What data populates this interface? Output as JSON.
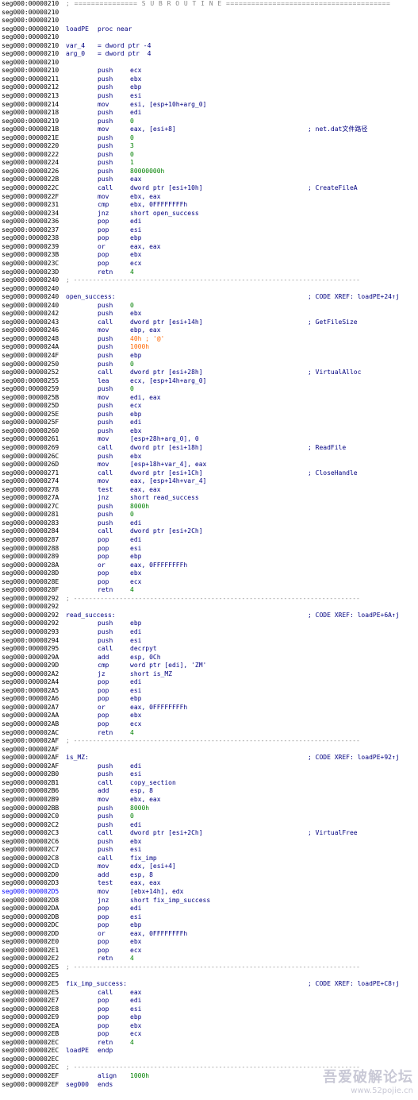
{
  "listing": {
    "lines": [
      {
        "addr": "seg000:00000210",
        "type": "banner",
        "text": "; =============== S U B R O U T I N E ======================================="
      },
      {
        "addr": "seg000:00000210"
      },
      {
        "addr": "seg000:00000210"
      },
      {
        "addr": "seg000:00000210",
        "label": "loadPE",
        "mnem": "proc near"
      },
      {
        "addr": "seg000:00000210"
      },
      {
        "addr": "seg000:00000210",
        "label": "var_4",
        "mnem": "= dword ptr -4"
      },
      {
        "addr": "seg000:00000210",
        "label": "arg_0",
        "mnem": "= dword ptr  4"
      },
      {
        "addr": "seg000:00000210"
      },
      {
        "addr": "seg000:00000210",
        "mnem": "push",
        "ops": "ecx"
      },
      {
        "addr": "seg000:00000211",
        "mnem": "push",
        "ops": "ebx"
      },
      {
        "addr": "seg000:00000212",
        "mnem": "push",
        "ops": "ebp"
      },
      {
        "addr": "seg000:00000213",
        "mnem": "push",
        "ops": "esi"
      },
      {
        "addr": "seg000:00000214",
        "mnem": "mov",
        "ops": "esi, [esp+10h+arg_0]"
      },
      {
        "addr": "seg000:00000218",
        "mnem": "push",
        "ops": "edi"
      },
      {
        "addr": "seg000:00000219",
        "mnem": "push",
        "ops": "0",
        "opsType": "num"
      },
      {
        "addr": "seg000:0000021B",
        "mnem": "mov",
        "ops": "eax, [esi+8]",
        "cmt": "; net.dat文件路径"
      },
      {
        "addr": "seg000:0000021E",
        "mnem": "push",
        "ops": "0",
        "opsType": "num"
      },
      {
        "addr": "seg000:00000220",
        "mnem": "push",
        "ops": "3",
        "opsType": "num"
      },
      {
        "addr": "seg000:00000222",
        "mnem": "push",
        "ops": "0",
        "opsType": "num"
      },
      {
        "addr": "seg000:00000224",
        "mnem": "push",
        "ops": "1",
        "opsType": "num"
      },
      {
        "addr": "seg000:00000226",
        "mnem": "push",
        "ops": "80000000h",
        "opsType": "num"
      },
      {
        "addr": "seg000:0000022B",
        "mnem": "push",
        "ops": "eax"
      },
      {
        "addr": "seg000:0000022C",
        "mnem": "call",
        "ops": "dword ptr [esi+10h]",
        "cmt": "; CreateFileA"
      },
      {
        "addr": "seg000:0000022F",
        "mnem": "mov",
        "ops": "ebx, eax"
      },
      {
        "addr": "seg000:00000231",
        "mnem": "cmp",
        "ops": "ebx, 0FFFFFFFFh"
      },
      {
        "addr": "seg000:00000234",
        "mnem": "jnz",
        "ops": "short open_success"
      },
      {
        "addr": "seg000:00000236",
        "mnem": "pop",
        "ops": "edi"
      },
      {
        "addr": "seg000:00000237",
        "mnem": "pop",
        "ops": "esi"
      },
      {
        "addr": "seg000:00000238",
        "mnem": "pop",
        "ops": "ebp"
      },
      {
        "addr": "seg000:00000239",
        "mnem": "or",
        "ops": "eax, eax"
      },
      {
        "addr": "seg000:0000023B",
        "mnem": "pop",
        "ops": "ebx"
      },
      {
        "addr": "seg000:0000023C",
        "mnem": "pop",
        "ops": "ecx"
      },
      {
        "addr": "seg000:0000023D",
        "mnem": "retn",
        "ops": "4",
        "opsType": "num"
      },
      {
        "addr": "seg000:00000240",
        "type": "sep",
        "text": "; ---------------------------------------------------------------------------"
      },
      {
        "addr": "seg000:00000240"
      },
      {
        "addr": "seg000:00000240",
        "label": "open_success:",
        "cmt": "; CODE XREF: loadPE+24↑j"
      },
      {
        "addr": "seg000:00000240",
        "mnem": "push",
        "ops": "0",
        "opsType": "num"
      },
      {
        "addr": "seg000:00000242",
        "mnem": "push",
        "ops": "ebx"
      },
      {
        "addr": "seg000:00000243",
        "mnem": "call",
        "ops": "dword ptr [esi+14h]",
        "cmt": "; GetFileSize"
      },
      {
        "addr": "seg000:00000246",
        "mnem": "mov",
        "ops": "ebp, eax"
      },
      {
        "addr": "seg000:00000248",
        "mnem": "push",
        "ops": "40h ; '@'",
        "opsType": "hex"
      },
      {
        "addr": "seg000:0000024A",
        "mnem": "push",
        "ops": "1000h",
        "opsType": "hex"
      },
      {
        "addr": "seg000:0000024F",
        "mnem": "push",
        "ops": "ebp"
      },
      {
        "addr": "seg000:00000250",
        "mnem": "push",
        "ops": "0",
        "opsType": "num"
      },
      {
        "addr": "seg000:00000252",
        "mnem": "call",
        "ops": "dword ptr [esi+28h]",
        "cmt": "; VirtualAlloc"
      },
      {
        "addr": "seg000:00000255",
        "mnem": "lea",
        "ops": "ecx, [esp+14h+arg_0]"
      },
      {
        "addr": "seg000:00000259",
        "mnem": "push",
        "ops": "0",
        "opsType": "num"
      },
      {
        "addr": "seg000:0000025B",
        "mnem": "mov",
        "ops": "edi, eax"
      },
      {
        "addr": "seg000:0000025D",
        "mnem": "push",
        "ops": "ecx"
      },
      {
        "addr": "seg000:0000025E",
        "mnem": "push",
        "ops": "ebp"
      },
      {
        "addr": "seg000:0000025F",
        "mnem": "push",
        "ops": "edi"
      },
      {
        "addr": "seg000:00000260",
        "mnem": "push",
        "ops": "ebx"
      },
      {
        "addr": "seg000:00000261",
        "mnem": "mov",
        "ops": "[esp+28h+arg_0], 0"
      },
      {
        "addr": "seg000:00000269",
        "mnem": "call",
        "ops": "dword ptr [esi+18h]",
        "cmt": "; ReadFile"
      },
      {
        "addr": "seg000:0000026C",
        "mnem": "push",
        "ops": "ebx"
      },
      {
        "addr": "seg000:0000026D",
        "mnem": "mov",
        "ops": "[esp+18h+var_4], eax"
      },
      {
        "addr": "seg000:00000271",
        "mnem": "call",
        "ops": "dword ptr [esi+1Ch]",
        "cmt": "; CloseHandle"
      },
      {
        "addr": "seg000:00000274",
        "mnem": "mov",
        "ops": "eax, [esp+14h+var_4]"
      },
      {
        "addr": "seg000:00000278",
        "mnem": "test",
        "ops": "eax, eax"
      },
      {
        "addr": "seg000:0000027A",
        "mnem": "jnz",
        "ops": "short read_success"
      },
      {
        "addr": "seg000:0000027C",
        "mnem": "push",
        "ops": "8000h",
        "opsType": "num"
      },
      {
        "addr": "seg000:00000281",
        "mnem": "push",
        "ops": "0",
        "opsType": "num"
      },
      {
        "addr": "seg000:00000283",
        "mnem": "push",
        "ops": "edi"
      },
      {
        "addr": "seg000:00000284",
        "mnem": "call",
        "ops": "dword ptr [esi+2Ch]"
      },
      {
        "addr": "seg000:00000287",
        "mnem": "pop",
        "ops": "edi"
      },
      {
        "addr": "seg000:00000288",
        "mnem": "pop",
        "ops": "esi"
      },
      {
        "addr": "seg000:00000289",
        "mnem": "pop",
        "ops": "ebp"
      },
      {
        "addr": "seg000:0000028A",
        "mnem": "or",
        "ops": "eax, 0FFFFFFFFh"
      },
      {
        "addr": "seg000:0000028D",
        "mnem": "pop",
        "ops": "ebx"
      },
      {
        "addr": "seg000:0000028E",
        "mnem": "pop",
        "ops": "ecx"
      },
      {
        "addr": "seg000:0000028F",
        "mnem": "retn",
        "ops": "4",
        "opsType": "num"
      },
      {
        "addr": "seg000:00000292",
        "type": "sep",
        "text": "; ---------------------------------------------------------------------------"
      },
      {
        "addr": "seg000:00000292"
      },
      {
        "addr": "seg000:00000292",
        "label": "read_success:",
        "cmt": "; CODE XREF: loadPE+6A↑j"
      },
      {
        "addr": "seg000:00000292",
        "mnem": "push",
        "ops": "ebp"
      },
      {
        "addr": "seg000:00000293",
        "mnem": "push",
        "ops": "edi"
      },
      {
        "addr": "seg000:00000294",
        "mnem": "push",
        "ops": "esi"
      },
      {
        "addr": "seg000:00000295",
        "mnem": "call",
        "ops": "decrpyt"
      },
      {
        "addr": "seg000:0000029A",
        "mnem": "add",
        "ops": "esp, 0Ch"
      },
      {
        "addr": "seg000:0000029D",
        "mnem": "cmp",
        "ops": "word ptr [edi], 'ZM'"
      },
      {
        "addr": "seg000:000002A2",
        "mnem": "jz",
        "ops": "short is_MZ"
      },
      {
        "addr": "seg000:000002A4",
        "mnem": "pop",
        "ops": "edi"
      },
      {
        "addr": "seg000:000002A5",
        "mnem": "pop",
        "ops": "esi"
      },
      {
        "addr": "seg000:000002A6",
        "mnem": "pop",
        "ops": "ebp"
      },
      {
        "addr": "seg000:000002A7",
        "mnem": "or",
        "ops": "eax, 0FFFFFFFFh"
      },
      {
        "addr": "seg000:000002AA",
        "mnem": "pop",
        "ops": "ebx"
      },
      {
        "addr": "seg000:000002AB",
        "mnem": "pop",
        "ops": "ecx"
      },
      {
        "addr": "seg000:000002AC",
        "mnem": "retn",
        "ops": "4",
        "opsType": "num"
      },
      {
        "addr": "seg000:000002AF",
        "type": "sep",
        "text": "; ---------------------------------------------------------------------------"
      },
      {
        "addr": "seg000:000002AF"
      },
      {
        "addr": "seg000:000002AF",
        "label": "is_MZ:",
        "cmt": "; CODE XREF: loadPE+92↑j"
      },
      {
        "addr": "seg000:000002AF",
        "mnem": "push",
        "ops": "edi"
      },
      {
        "addr": "seg000:000002B0",
        "mnem": "push",
        "ops": "esi"
      },
      {
        "addr": "seg000:000002B1",
        "mnem": "call",
        "ops": "copy_section"
      },
      {
        "addr": "seg000:000002B6",
        "mnem": "add",
        "ops": "esp, 8"
      },
      {
        "addr": "seg000:000002B9",
        "mnem": "mov",
        "ops": "ebx, eax"
      },
      {
        "addr": "seg000:000002BB",
        "mnem": "push",
        "ops": "8000h",
        "opsType": "num"
      },
      {
        "addr": "seg000:000002C0",
        "mnem": "push",
        "ops": "0",
        "opsType": "num"
      },
      {
        "addr": "seg000:000002C2",
        "mnem": "push",
        "ops": "edi"
      },
      {
        "addr": "seg000:000002C3",
        "mnem": "call",
        "ops": "dword ptr [esi+2Ch]",
        "cmt": "; VirtualFree"
      },
      {
        "addr": "seg000:000002C6",
        "mnem": "push",
        "ops": "ebx"
      },
      {
        "addr": "seg000:000002C7",
        "mnem": "push",
        "ops": "esi"
      },
      {
        "addr": "seg000:000002C8",
        "mnem": "call",
        "ops": "fix_imp"
      },
      {
        "addr": "seg000:000002CD",
        "mnem": "mov",
        "ops": "edx, [esi+4]"
      },
      {
        "addr": "seg000:000002D0",
        "mnem": "add",
        "ops": "esp, 8"
      },
      {
        "addr": "seg000:000002D3",
        "mnem": "test",
        "ops": "eax, eax"
      },
      {
        "addr": "seg000:000002D5",
        "mnem": "mov",
        "ops": "[ebx+14h], edx",
        "hl": true
      },
      {
        "addr": "seg000:000002D8",
        "mnem": "jnz",
        "ops": "short fix_imp_success"
      },
      {
        "addr": "seg000:000002DA",
        "mnem": "pop",
        "ops": "edi"
      },
      {
        "addr": "seg000:000002DB",
        "mnem": "pop",
        "ops": "esi"
      },
      {
        "addr": "seg000:000002DC",
        "mnem": "pop",
        "ops": "ebp"
      },
      {
        "addr": "seg000:000002DD",
        "mnem": "or",
        "ops": "eax, 0FFFFFFFFh"
      },
      {
        "addr": "seg000:000002E0",
        "mnem": "pop",
        "ops": "ebx"
      },
      {
        "addr": "seg000:000002E1",
        "mnem": "pop",
        "ops": "ecx"
      },
      {
        "addr": "seg000:000002E2",
        "mnem": "retn",
        "ops": "4",
        "opsType": "num"
      },
      {
        "addr": "seg000:000002E5",
        "type": "sep",
        "text": "; ---------------------------------------------------------------------------"
      },
      {
        "addr": "seg000:000002E5"
      },
      {
        "addr": "seg000:000002E5",
        "label": "fix_imp_success:",
        "cmt": "; CODE XREF: loadPE+C8↑j"
      },
      {
        "addr": "seg000:000002E5",
        "mnem": "call",
        "ops": "eax"
      },
      {
        "addr": "seg000:000002E7",
        "mnem": "pop",
        "ops": "edi"
      },
      {
        "addr": "seg000:000002E8",
        "mnem": "pop",
        "ops": "esi"
      },
      {
        "addr": "seg000:000002E9",
        "mnem": "pop",
        "ops": "ebp"
      },
      {
        "addr": "seg000:000002EA",
        "mnem": "pop",
        "ops": "ebx"
      },
      {
        "addr": "seg000:000002EB",
        "mnem": "pop",
        "ops": "ecx"
      },
      {
        "addr": "seg000:000002EC",
        "mnem": "retn",
        "ops": "4",
        "opsType": "num"
      },
      {
        "addr": "seg000:000002EC",
        "label": "loadPE",
        "mnem": "endp"
      },
      {
        "addr": "seg000:000002EC"
      },
      {
        "addr": "seg000:000002EC",
        "type": "sep",
        "text": "; ---------------------------------------------------------------------------"
      },
      {
        "addr": "seg000:000002EF",
        "mnem": "align",
        "ops": "1000h",
        "opsType": "num"
      },
      {
        "addr": "seg000:000002EF",
        "label": "seg000",
        "mnem": "ends"
      }
    ]
  },
  "watermark": {
    "title": "吾爱破解论坛",
    "url": "www.52pojie.cn"
  },
  "colors": {
    "background": "#ffffff",
    "code": "#000080",
    "address": "#000000",
    "address_highlight": "#0000ff",
    "number": "#008000",
    "hex_number": "#ff6600",
    "separator": "#888888",
    "xref_arrow": "#ff8800"
  }
}
